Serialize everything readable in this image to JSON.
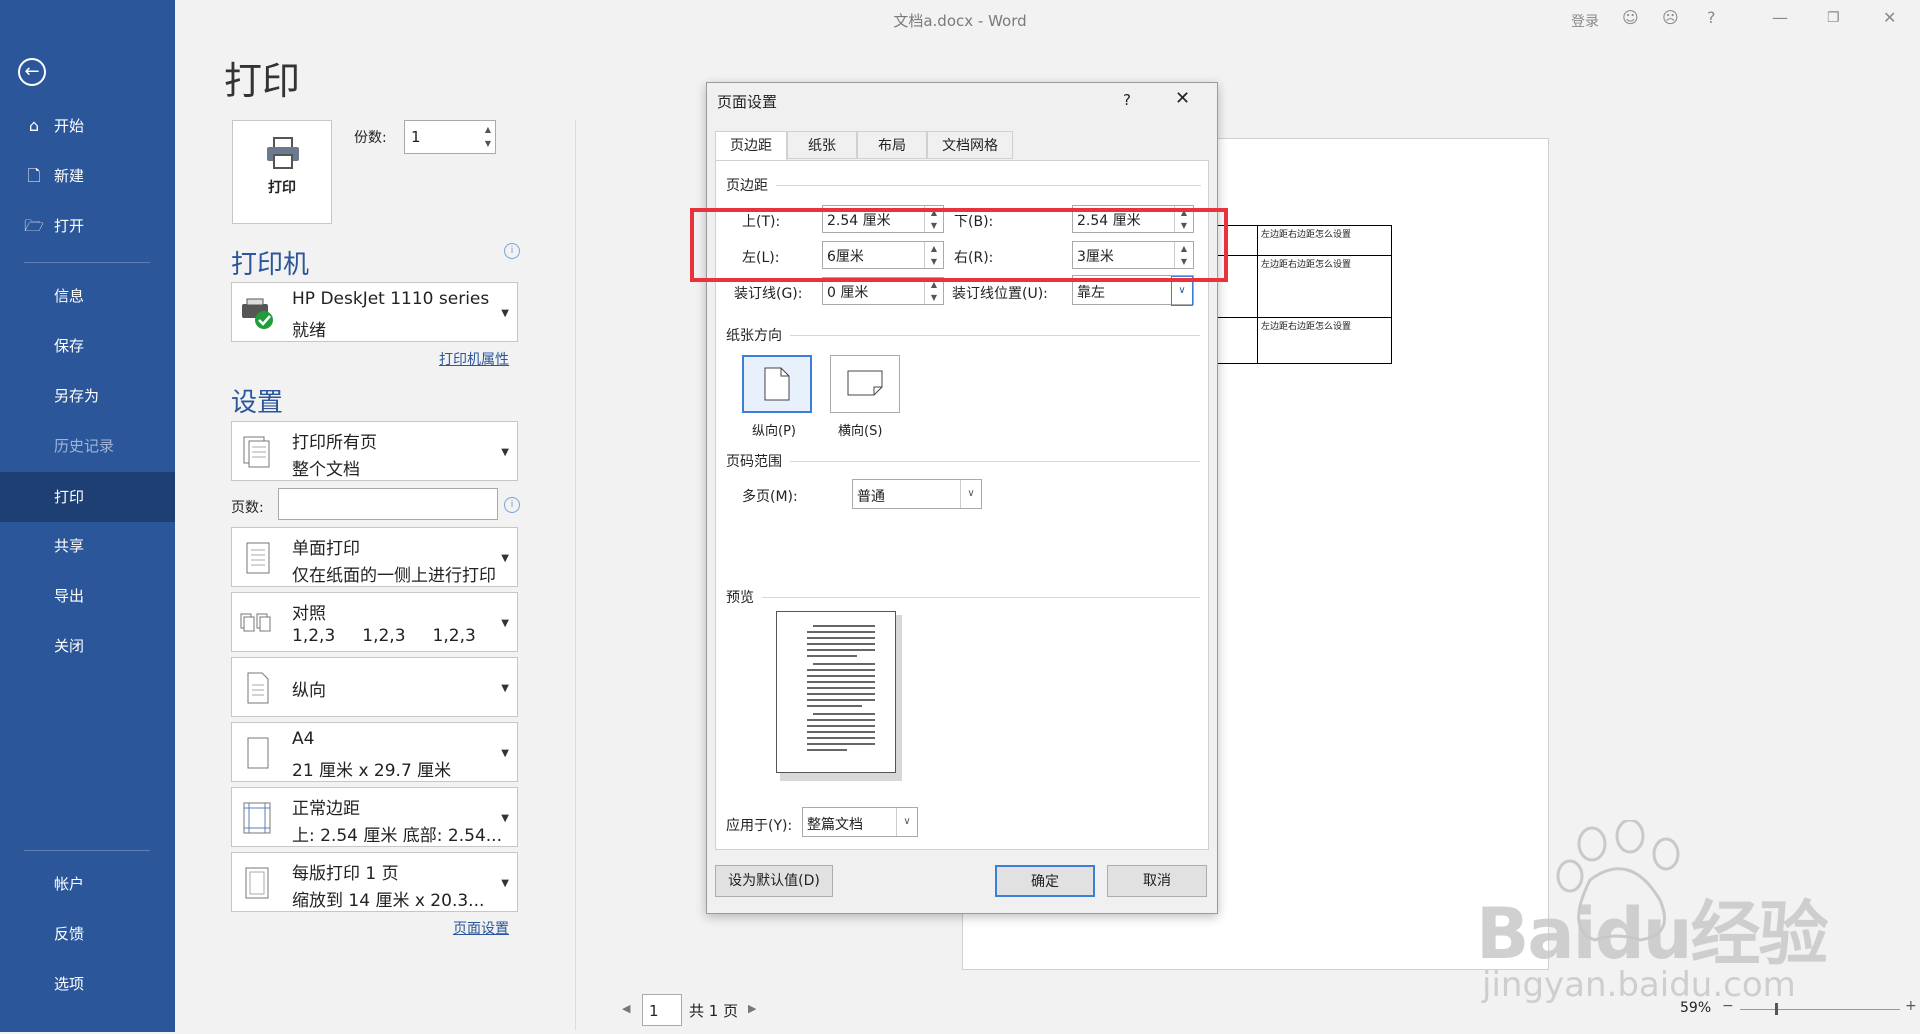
{
  "window": {
    "title": "文档a.docx  -  Word",
    "signin": "登录"
  },
  "nav": {
    "items": [
      {
        "label": "开始",
        "icon": "home-icon"
      },
      {
        "label": "新建",
        "icon": "new-document-icon"
      },
      {
        "label": "打开",
        "icon": "open-folder-icon"
      },
      {
        "label": "信息"
      },
      {
        "label": "保存"
      },
      {
        "label": "另存为"
      },
      {
        "label": "历史记录"
      },
      {
        "label": "打印"
      },
      {
        "label": "共享"
      },
      {
        "label": "导出"
      },
      {
        "label": "关闭"
      },
      {
        "label": "帐户"
      },
      {
        "label": "反馈"
      },
      {
        "label": "选项"
      }
    ]
  },
  "print": {
    "title": "打印",
    "print_button": "打印",
    "copies_label": "份数:",
    "copies_value": "1",
    "printer_heading": "打印机",
    "printer_name": "HP DeskJet 1110 series",
    "printer_status": "就绪",
    "printer_props_link": "打印机属性",
    "settings_heading": "设置",
    "settings": [
      {
        "line1": "打印所有页",
        "line2": "整个文档"
      },
      {
        "line1": "单面打印",
        "line2": "仅在纸面的一侧上进行打印"
      },
      {
        "line1": "对照",
        "line2": "1,2,3     1,2,3     1,2,3"
      },
      {
        "line1": "纵向",
        "line2": ""
      },
      {
        "line1": "A4",
        "line2": "21 厘米 x 29.7 厘米"
      },
      {
        "line1": "正常边距",
        "line2": "上: 2.54 厘米 底部: 2.54..."
      },
      {
        "line1": "每版打印 1 页",
        "line2": "缩放到 14 厘米 x 20.3..."
      }
    ],
    "pages_label": "页数:",
    "pages_value": "",
    "page_setup_link": "页面设置"
  },
  "preview": {
    "cells": [
      "左边距右边距怎么设置",
      "左边距右边距怎么设置",
      "左边距右边距怎么设置"
    ]
  },
  "dialog": {
    "title": "页面设置",
    "help": "?",
    "tabs": [
      "页边距",
      "纸张",
      "布局",
      "文档网格"
    ],
    "margins_group": "页边距",
    "top_label": "上(T):",
    "top_value": "2.54 厘米",
    "bottom_label": "下(B):",
    "bottom_value": "2.54 厘米",
    "left_label": "左(L):",
    "left_value": "6厘米",
    "right_label": "右(R):",
    "right_value": "3厘米",
    "gutter_label": "装订线(G):",
    "gutter_value": "0 厘米",
    "gutter_pos_label": "装订线位置(U):",
    "gutter_pos_value": "靠左",
    "orientation_group": "纸张方向",
    "portrait_label": "纵向(P)",
    "landscape_label": "横向(S)",
    "pages_group": "页码范围",
    "multi_pages_label": "多页(M):",
    "multi_pages_value": "普通",
    "preview_group": "预览",
    "apply_label": "应用于(Y):",
    "apply_value": "整篇文档",
    "default_button": "设为默认值(D)",
    "ok_button": "确定",
    "cancel_button": "取消"
  },
  "bottom": {
    "page_value": "1",
    "page_total": "共 1 页",
    "zoom": "59%"
  },
  "watermark": {
    "brand": "Baidu经验",
    "url": "jingyan.baidu.com"
  },
  "colors": {
    "nav_bg": "#2b579a",
    "accent": "#2b579a",
    "highlight": "#e8333d"
  }
}
